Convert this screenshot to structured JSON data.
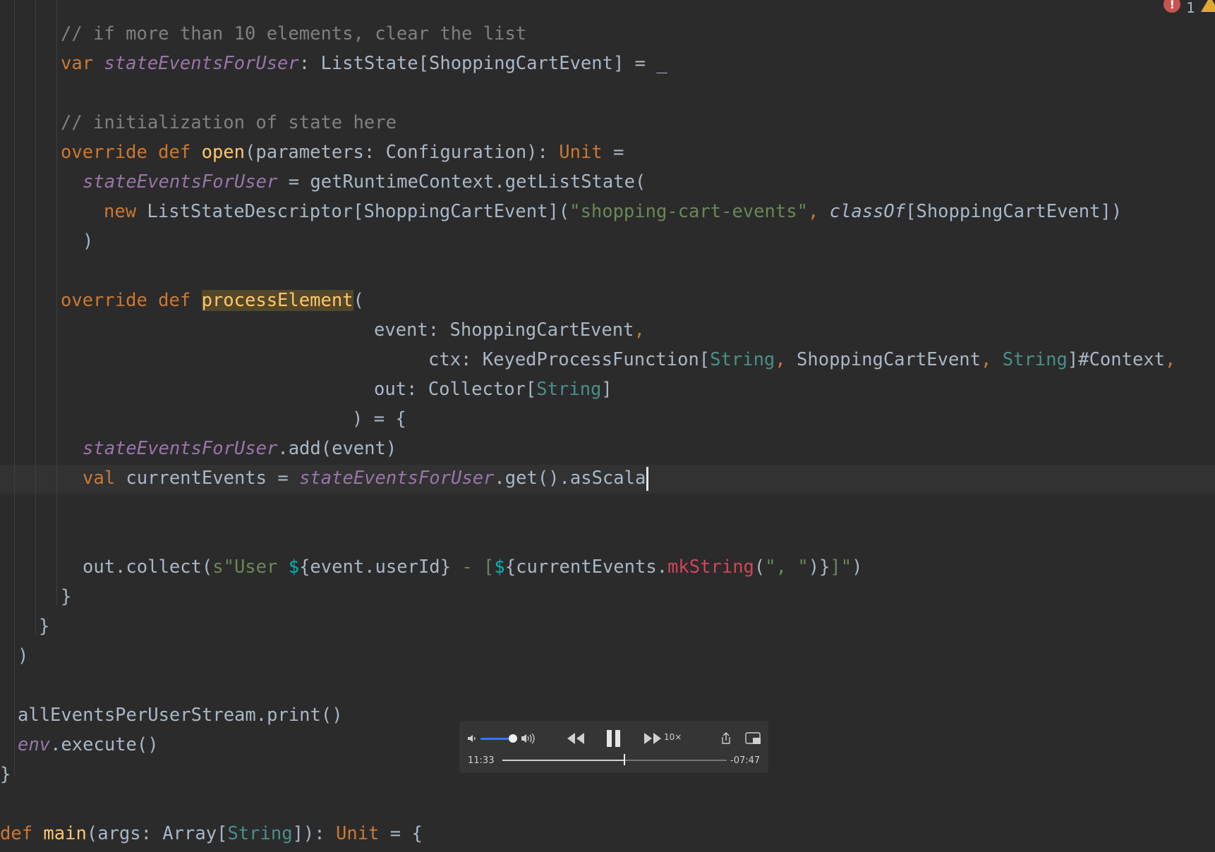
{
  "inspections": {
    "errors": "1",
    "colors": {
      "error": "#c75450",
      "warning": "#e0a82e"
    }
  },
  "editor": {
    "lines": [
      {
        "parts": [
          [
            "cmt",
            "// if more than 10 elements, clear the list"
          ]
        ]
      },
      {
        "parts": [
          [
            "kw",
            "var "
          ],
          [
            "field",
            "stateEventsForUser"
          ],
          [
            "dim",
            ": ListState[ShoppingCartEvent] = _"
          ]
        ]
      },
      {
        "parts": []
      },
      {
        "parts": [
          [
            "cmt",
            "// initialization of state here"
          ]
        ]
      },
      {
        "parts": [
          [
            "kw",
            "override def "
          ],
          [
            "fn",
            "open"
          ],
          [
            "dim",
            "(parameters: Configuration): "
          ],
          [
            "kw",
            "Unit"
          ],
          [
            "dim",
            " ="
          ]
        ]
      },
      {
        "parts": [
          [
            "field",
            "stateEventsForUser"
          ],
          [
            "dim",
            " = getRuntimeContext.getListState("
          ]
        ]
      },
      {
        "parts": [
          [
            "kw",
            "new "
          ],
          [
            "dim",
            "ListStateDescriptor[ShoppingCartEvent]("
          ],
          [
            "str",
            "\"shopping-cart-events\""
          ],
          [
            "kw",
            ", "
          ],
          [
            "ital",
            "classOf"
          ],
          [
            "dim",
            "[ShoppingCartEvent])"
          ]
        ]
      },
      {
        "parts": [
          [
            "dim",
            ")"
          ]
        ]
      },
      {
        "parts": []
      },
      {
        "parts": [
          [
            "kw",
            "override def "
          ],
          [
            "hl",
            "processElement"
          ],
          [
            "dim",
            "("
          ]
        ]
      },
      {
        "parts": [
          [
            "dim",
            "event: ShoppingCartEvent"
          ],
          [
            "kw",
            ","
          ]
        ]
      },
      {
        "parts": [
          [
            "dim",
            "ctx: KeyedProcessFunction["
          ],
          [
            "typ",
            "String"
          ],
          [
            "kw",
            ", "
          ],
          [
            "dim",
            "ShoppingCartEvent"
          ],
          [
            "kw",
            ", "
          ],
          [
            "typ",
            "String"
          ],
          [
            "dim",
            "]#Context"
          ],
          [
            "kw",
            ","
          ]
        ]
      },
      {
        "parts": [
          [
            "dim",
            "out: Collector["
          ],
          [
            "typ",
            "String"
          ],
          [
            "dim",
            "]"
          ]
        ]
      },
      {
        "parts": [
          [
            "dim",
            ") = {"
          ]
        ]
      },
      {
        "parts": [
          [
            "field",
            "stateEventsForUser"
          ],
          [
            "dim",
            ".add(event)"
          ]
        ]
      },
      {
        "parts": [
          [
            "kw",
            "val "
          ],
          [
            "dim",
            "currentEvents = "
          ],
          [
            "field",
            "stateEventsForUser"
          ],
          [
            "dim",
            ".get().asScala"
          ]
        ]
      },
      {
        "parts": []
      },
      {
        "parts": []
      },
      {
        "parts": [
          [
            "dim",
            "out.collect("
          ],
          [
            "str",
            "s\"User "
          ],
          [
            "interp",
            "$"
          ],
          [
            "dim",
            "{event.userId}"
          ],
          [
            "str",
            " - ["
          ],
          [
            "interp",
            "$"
          ],
          [
            "dim",
            "{currentEvents."
          ],
          [
            "red",
            "mkString"
          ],
          [
            "dim",
            "("
          ],
          [
            "str",
            "\", \""
          ],
          [
            "dim",
            ")}"
          ],
          [
            "str",
            "]\""
          ],
          [
            "dim",
            ")"
          ]
        ]
      },
      {
        "parts": [
          [
            "dim",
            "}"
          ]
        ]
      },
      {
        "parts": [
          [
            "dim",
            "}"
          ]
        ]
      },
      {
        "parts": [
          [
            "dim",
            ")"
          ]
        ]
      },
      {
        "parts": []
      },
      {
        "parts": [
          [
            "dim",
            "allEventsPerUserStream.print()"
          ]
        ]
      },
      {
        "parts": [
          [
            "field",
            "env"
          ],
          [
            "dim",
            ".execute()"
          ]
        ]
      },
      {
        "parts": [
          [
            "dim",
            "}"
          ]
        ]
      },
      {
        "parts": []
      },
      {
        "parts": [
          [
            "kw",
            "def "
          ],
          [
            "fn",
            "main"
          ],
          [
            "dim",
            "(args: Array["
          ],
          [
            "typ",
            "String"
          ],
          [
            "dim",
            "]): "
          ],
          [
            "kw",
            "Unit"
          ],
          [
            "dim",
            " = {"
          ]
        ]
      }
    ]
  },
  "player": {
    "elapsed": "11:33",
    "remaining": "-07:47",
    "speed_label": "10×",
    "progress": 0.54,
    "volume": 0.85,
    "icons": [
      "volume-low-icon",
      "volume-high-icon",
      "rewind-icon",
      "pause-icon",
      "fast-forward-icon",
      "share-icon",
      "pip-icon"
    ]
  }
}
